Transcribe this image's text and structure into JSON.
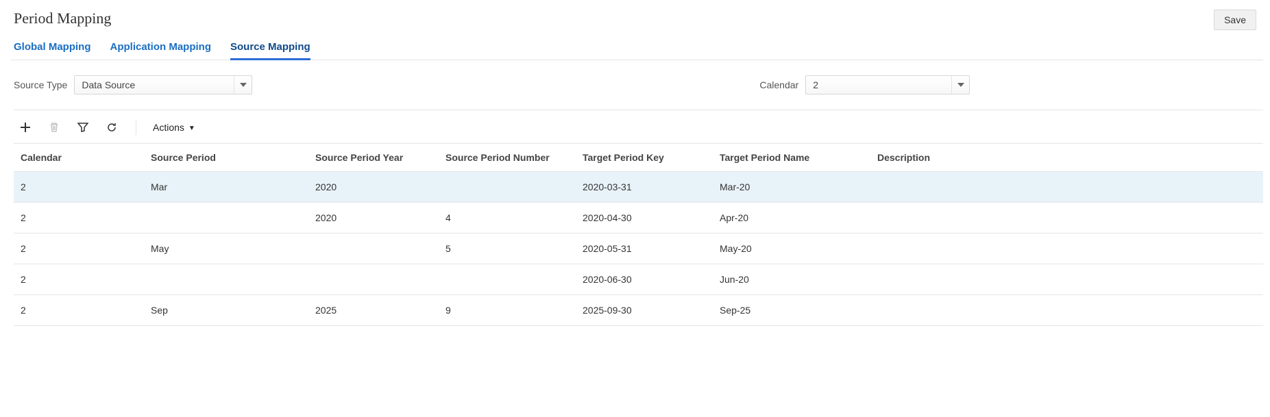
{
  "header": {
    "title": "Period Mapping",
    "save_label": "Save"
  },
  "tabs": [
    {
      "label": "Global Mapping",
      "active": false
    },
    {
      "label": "Application Mapping",
      "active": false
    },
    {
      "label": "Source Mapping",
      "active": true
    }
  ],
  "filters": {
    "source_type_label": "Source Type",
    "source_type_value": "Data Source",
    "calendar_label": "Calendar",
    "calendar_value": "2"
  },
  "actions": {
    "label": "Actions"
  },
  "table": {
    "headers": {
      "calendar": "Calendar",
      "source_period": "Source Period",
      "source_period_year": "Source Period Year",
      "source_period_number": "Source Period Number",
      "target_period_key": "Target Period Key",
      "target_period_name": "Target Period Name",
      "description": "Description"
    },
    "rows": [
      {
        "calendar": "2",
        "source_period": "Mar",
        "source_period_year": "2020",
        "source_period_number": "",
        "target_period_key": "2020-03-31",
        "target_period_name": "Mar-20",
        "description": "",
        "selected": true
      },
      {
        "calendar": "2",
        "source_period": "",
        "source_period_year": "2020",
        "source_period_number": "4",
        "target_period_key": "2020-04-30",
        "target_period_name": "Apr-20",
        "description": "",
        "selected": false
      },
      {
        "calendar": "2",
        "source_period": "May",
        "source_period_year": "",
        "source_period_number": "5",
        "target_period_key": "2020-05-31",
        "target_period_name": "May-20",
        "description": "",
        "selected": false
      },
      {
        "calendar": "2",
        "source_period": "",
        "source_period_year": "",
        "source_period_number": "",
        "target_period_key": "2020-06-30",
        "target_period_name": "Jun-20",
        "description": "",
        "selected": false
      },
      {
        "calendar": "2",
        "source_period": "Sep",
        "source_period_year": "2025",
        "source_period_number": "9",
        "target_period_key": "2025-09-30",
        "target_period_name": "Sep-25",
        "description": "",
        "selected": false
      }
    ]
  }
}
